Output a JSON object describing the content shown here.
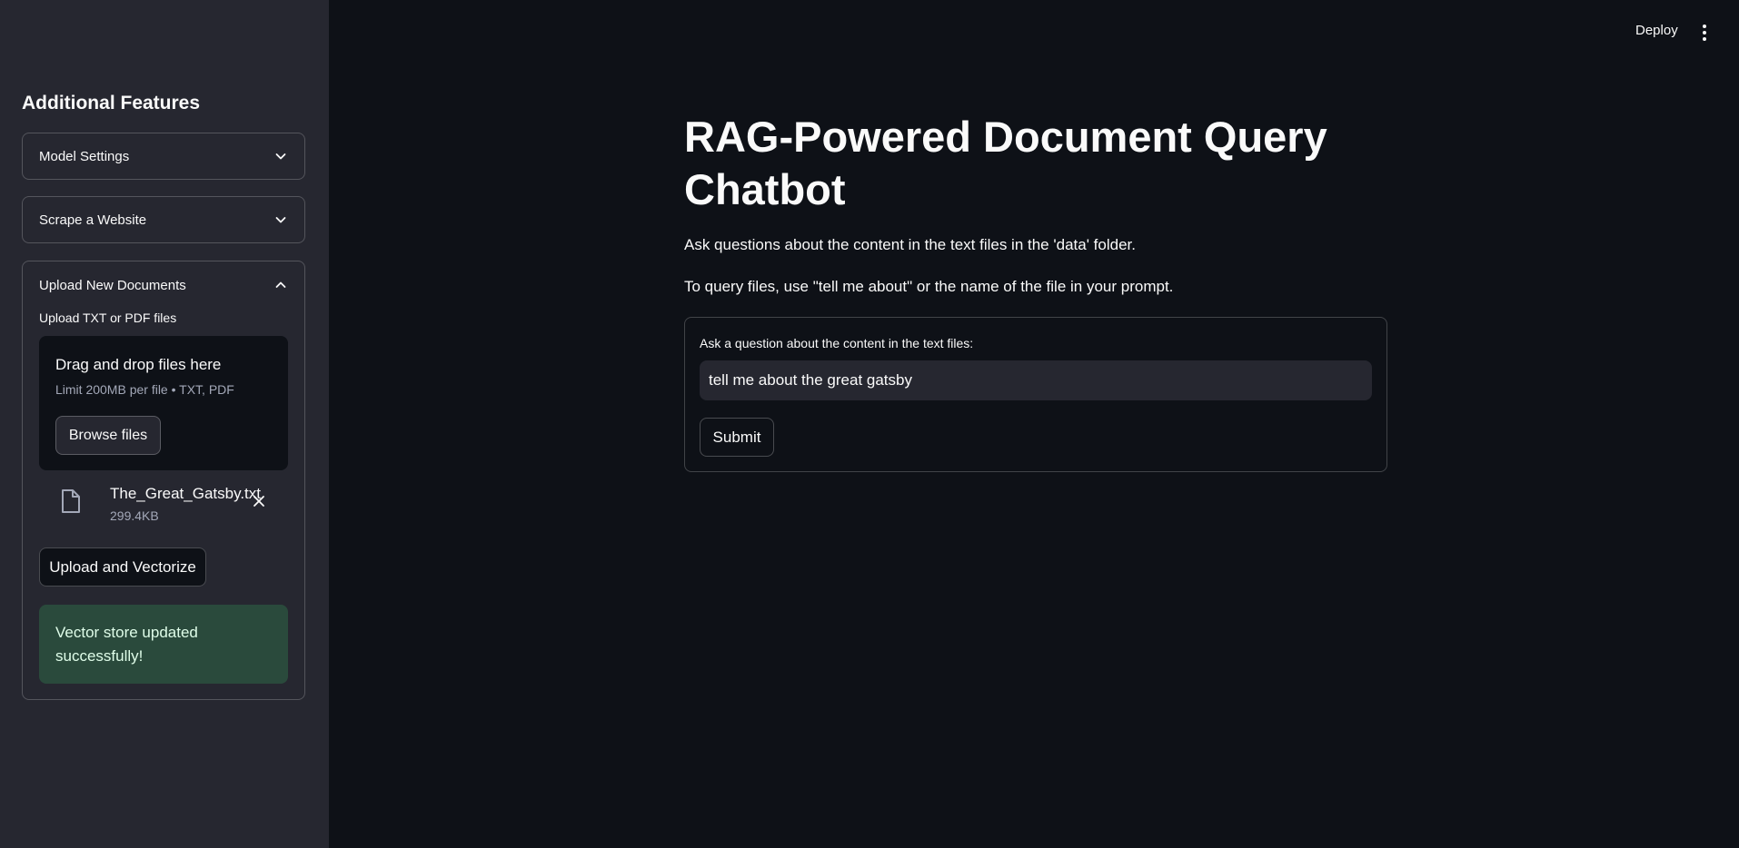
{
  "header": {
    "deploy_label": "Deploy",
    "menu_icon": "more-vertical-icon"
  },
  "sidebar": {
    "title": "Additional Features",
    "expanders": [
      {
        "label": "Model Settings",
        "expanded": false
      },
      {
        "label": "Scrape a Website",
        "expanded": false
      },
      {
        "label": "Upload New Documents",
        "expanded": true
      }
    ],
    "uploader": {
      "label": "Upload TXT or PDF files",
      "drop_title": "Drag and drop files here",
      "limit_text": "Limit 200MB per file • TXT, PDF",
      "browse_label": "Browse files",
      "file": {
        "name": "The_Great_Gatsby.txt",
        "size": "299.4KB"
      }
    },
    "upload_vectorize_label": "Upload and Vectorize",
    "success_message": "Vector store updated successfully!"
  },
  "main": {
    "title": "RAG-Powered Document Query Chatbot",
    "description_1": "Ask questions about the content in the text files in the 'data' folder.",
    "description_2": "To query files, use \"tell me about\" or the name of the file in your prompt.",
    "form": {
      "question_label": "Ask a question about the content in the text files:",
      "question_value": "tell me about the great gatsby",
      "submit_label": "Submit"
    }
  },
  "colors": {
    "background": "#0e1117",
    "sidebar": "#262730",
    "success_bg": "#2b4a3c",
    "text": "#fafafa"
  }
}
